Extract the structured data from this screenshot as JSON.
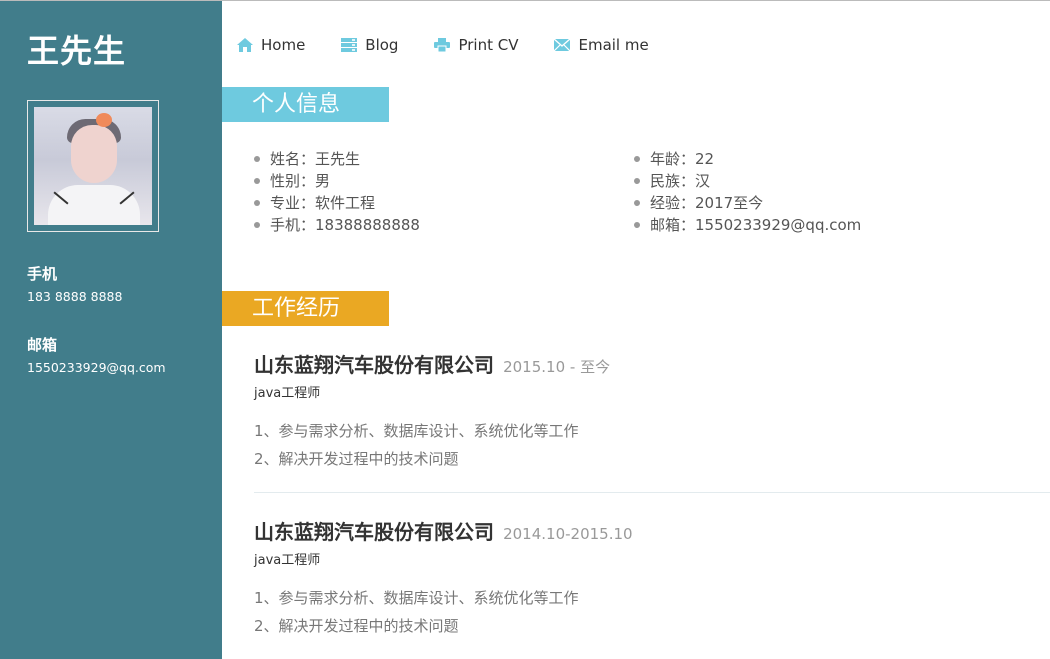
{
  "sidebar": {
    "owner_name": "王先生",
    "phone_label": "手机",
    "phone_value": "183 8888 8888",
    "email_label": "邮箱",
    "email_value": "1550233929@qq.com"
  },
  "nav": {
    "items": [
      {
        "label": "Home",
        "icon": "home-icon"
      },
      {
        "label": "Blog",
        "icon": "server-icon"
      },
      {
        "label": "Print CV",
        "icon": "printer-icon"
      },
      {
        "label": "Email me",
        "icon": "envelope-icon"
      }
    ]
  },
  "personal": {
    "title": "个人信息",
    "left": [
      "姓名：王先生",
      "性别：男",
      "专业：软件工程",
      "手机：18388888888"
    ],
    "right": [
      "年龄：22",
      "民族：汉",
      "经验：2017至今",
      "邮箱：1550233929@qq.com"
    ]
  },
  "work": {
    "title": "工作经历",
    "jobs": [
      {
        "company": "山东蓝翔汽车股份有限公司",
        "period": "2015.10 - 至今",
        "role": "java工程师",
        "duties": [
          "1、参与需求分析、数据库设计、系统优化等工作",
          "2、解决开发过程中的技术问题"
        ]
      },
      {
        "company": "山东蓝翔汽车股份有限公司",
        "period": "2014.10-2015.10",
        "role": "java工程师",
        "duties": [
          "1、参与需求分析、数据库设计、系统优化等工作",
          "2、解决开发过程中的技术问题"
        ]
      }
    ]
  },
  "colors": {
    "sidebar_bg": "#417d8b",
    "accent_blue": "#6ecadf",
    "accent_orange": "#eaa823"
  }
}
